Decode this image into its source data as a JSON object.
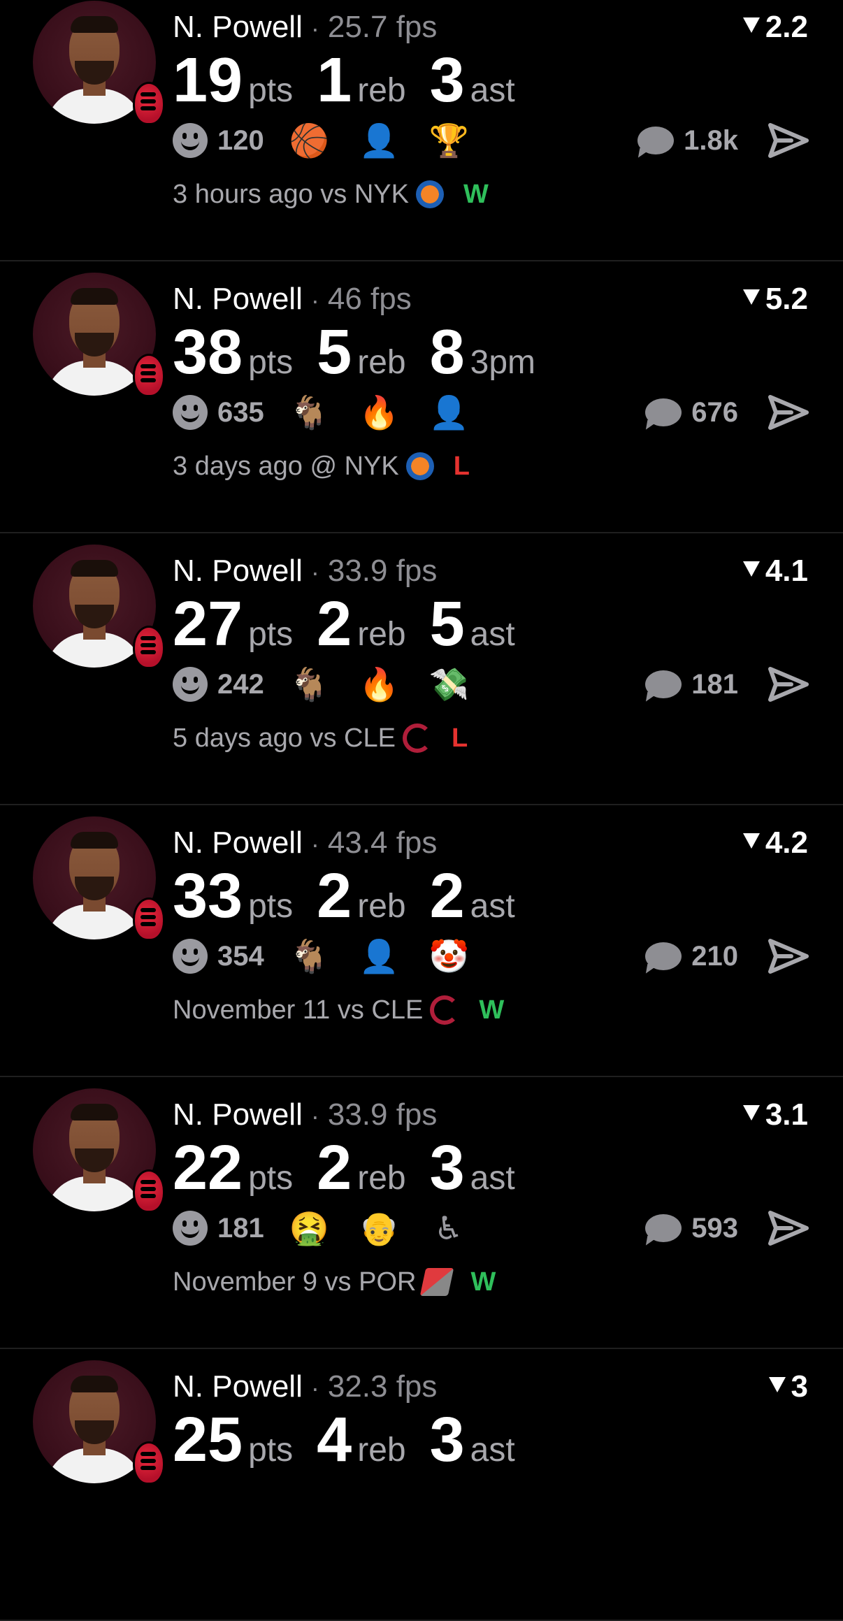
{
  "colors": {
    "background": "#000000",
    "win": "#2fbf5b",
    "loss": "#e5322f",
    "muted": "#a8a8ad"
  },
  "cards": [
    {
      "player": "N. Powell",
      "fps": "25.7 fps",
      "rating": "2.2",
      "stats": [
        {
          "num": "19",
          "unit": "pts"
        },
        {
          "num": "1",
          "unit": "reb"
        },
        {
          "num": "3",
          "unit": "ast"
        }
      ],
      "reaction_count": "120",
      "reaction_emojis": [
        "basketball-hoop-icon",
        "nets-player-icon",
        "dunk-icon"
      ],
      "reaction_glyphs": [
        "🏀",
        "👤",
        "🏆"
      ],
      "comment_count": "1.8k",
      "when": "3 hours ago vs NYK",
      "opponent_logo": "nyk",
      "result": "W"
    },
    {
      "player": "N. Powell",
      "fps": "46 fps",
      "rating": "5.2",
      "stats": [
        {
          "num": "38",
          "unit": "pts"
        },
        {
          "num": "5",
          "unit": "reb"
        },
        {
          "num": "8",
          "unit": "3pm"
        }
      ],
      "reaction_count": "635",
      "reaction_emojis": [
        "goat-icon",
        "fire-icon",
        "face-icon"
      ],
      "reaction_glyphs": [
        "🐐",
        "🔥",
        "👤"
      ],
      "comment_count": "676",
      "when": "3 days ago @ NYK",
      "opponent_logo": "nyk",
      "result": "L"
    },
    {
      "player": "N. Powell",
      "fps": "33.9 fps",
      "rating": "4.1",
      "stats": [
        {
          "num": "27",
          "unit": "pts"
        },
        {
          "num": "2",
          "unit": "reb"
        },
        {
          "num": "5",
          "unit": "ast"
        }
      ],
      "reaction_count": "242",
      "reaction_emojis": [
        "goat-icon",
        "fire-icon",
        "money-icon"
      ],
      "reaction_glyphs": [
        "🐐",
        "🔥",
        "💸"
      ],
      "comment_count": "181",
      "when": "5 days ago vs CLE",
      "opponent_logo": "cle",
      "result": "L"
    },
    {
      "player": "N. Powell",
      "fps": "43.4 fps",
      "rating": "4.2",
      "stats": [
        {
          "num": "33",
          "unit": "pts"
        },
        {
          "num": "2",
          "unit": "reb"
        },
        {
          "num": "2",
          "unit": "ast"
        }
      ],
      "reaction_count": "354",
      "reaction_emojis": [
        "goat-icon",
        "nets-player-icon",
        "clown-icon"
      ],
      "reaction_glyphs": [
        "🐐",
        "👤",
        "🤡"
      ],
      "comment_count": "210",
      "when": "November 11 vs CLE",
      "opponent_logo": "cle",
      "result": "W"
    },
    {
      "player": "N. Powell",
      "fps": "33.9 fps",
      "rating": "3.1",
      "stats": [
        {
          "num": "22",
          "unit": "pts"
        },
        {
          "num": "2",
          "unit": "reb"
        },
        {
          "num": "3",
          "unit": "ast"
        }
      ],
      "reaction_count": "181",
      "reaction_emojis": [
        "vomit-icon",
        "walker-icon",
        "wheelchair-icon"
      ],
      "reaction_glyphs": [
        "🤮",
        "👴",
        "♿"
      ],
      "comment_count": "593",
      "when": "November 9 vs POR",
      "opponent_logo": "por",
      "result": "W"
    },
    {
      "player": "N. Powell",
      "fps": "32.3 fps",
      "rating": "3",
      "stats": [
        {
          "num": "25",
          "unit": "pts"
        },
        {
          "num": "4",
          "unit": "reb"
        },
        {
          "num": "3",
          "unit": "ast"
        }
      ]
    }
  ]
}
